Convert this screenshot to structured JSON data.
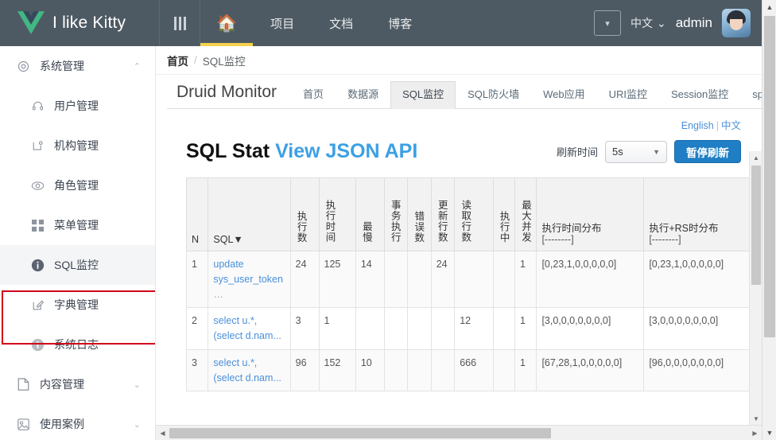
{
  "header": {
    "brand_title": "I like Kitty",
    "logo_icon": "vue-logo-icon",
    "menu_icon": "hamburger-icon",
    "home_icon": "home-icon",
    "nav": [
      {
        "label": "项目"
      },
      {
        "label": "文档"
      },
      {
        "label": "博客"
      }
    ],
    "collapse_icon": "chevron-down-icon",
    "lang_label": "中文",
    "lang_caret": "⌄",
    "username": "admin",
    "avatar": "user-avatar"
  },
  "sidebar": {
    "items": [
      {
        "label": "系统管理",
        "icon": "gear-icon",
        "level": "group",
        "arrow": "⌃",
        "selected": false
      },
      {
        "label": "用户管理",
        "icon": "headset-icon",
        "level": "sub",
        "arrow": "",
        "selected": false
      },
      {
        "label": "机构管理",
        "icon": "org-icon",
        "level": "sub",
        "arrow": "",
        "selected": false
      },
      {
        "label": "角色管理",
        "icon": "eye-icon",
        "level": "sub",
        "arrow": "",
        "selected": false
      },
      {
        "label": "菜单管理",
        "icon": "grid-icon",
        "level": "sub",
        "arrow": "",
        "selected": false
      },
      {
        "label": "SQL监控",
        "icon": "info-icon",
        "level": "sub",
        "arrow": "",
        "selected": true
      },
      {
        "label": "字典管理",
        "icon": "edit-icon",
        "level": "sub",
        "arrow": "",
        "selected": false
      },
      {
        "label": "系统日志",
        "icon": "info-icon",
        "level": "sub",
        "arrow": "",
        "selected": false
      },
      {
        "label": "内容管理",
        "icon": "doc-icon",
        "level": "group",
        "arrow": "⌄",
        "selected": false
      },
      {
        "label": "使用案例",
        "icon": "case-icon",
        "level": "group",
        "arrow": "⌄",
        "selected": false
      }
    ],
    "highlight_color": "#d0021b"
  },
  "breadcrumb": {
    "home": "首页",
    "separator": "/",
    "current": "SQL监控"
  },
  "druid": {
    "brand": "Druid Monitor",
    "tabs": [
      {
        "label": "首页",
        "active": false
      },
      {
        "label": "数据源",
        "active": false
      },
      {
        "label": "SQL监控",
        "active": true
      },
      {
        "label": "SQL防火墙",
        "active": false
      },
      {
        "label": "Web应用",
        "active": false
      },
      {
        "label": "URI监控",
        "active": false
      },
      {
        "label": "Session监控",
        "active": false
      },
      {
        "label": "spring监控",
        "active": false
      }
    ],
    "lang_english": "English",
    "lang_separator": "|",
    "lang_chinese": "中文",
    "stat_title": "SQL Stat ",
    "stat_api_link": "View JSON API",
    "refresh_label": "刷新时间",
    "refresh_value": "5s",
    "refresh_caret": "▼",
    "pause_button": "暂停刷新",
    "accent_blue": "#1f7ec4"
  },
  "table": {
    "columns": [
      {
        "key": "n",
        "label": "N",
        "vertical": false
      },
      {
        "key": "sql",
        "label": "SQL▼",
        "vertical": false
      },
      {
        "key": "exec_count",
        "label": "执行数",
        "vertical": true
      },
      {
        "key": "exec_time",
        "label": "执行时间",
        "vertical": true
      },
      {
        "key": "slowest",
        "label": "最慢",
        "vertical": true
      },
      {
        "key": "tx_exec",
        "label": "事务执行",
        "vertical": true
      },
      {
        "key": "err_count",
        "label": "错误数",
        "vertical": true
      },
      {
        "key": "update_rows",
        "label": "更新行数",
        "vertical": true
      },
      {
        "key": "read_rows",
        "label": "读取行数",
        "vertical": true
      },
      {
        "key": "running",
        "label": "执行中",
        "vertical": true
      },
      {
        "key": "max_conc",
        "label": "最大并发",
        "vertical": true
      },
      {
        "key": "exec_dist",
        "label": "执行时间分布",
        "label2": "[--------]",
        "vertical": false
      },
      {
        "key": "rs_dist",
        "label": "执行+RS时分布",
        "label2": "[--------]",
        "vertical": false
      }
    ],
    "rows": [
      {
        "n": "1",
        "sql_line1": "update",
        "sql_line2": "sys_user_token",
        "sql_ellipsis": "…",
        "exec_count": "24",
        "exec_time": "125",
        "slowest": "14",
        "tx_exec": "",
        "err_count": "",
        "update_rows": "24",
        "read_rows": "",
        "running": "",
        "max_conc": "1",
        "exec_dist": "[0,23,1,0,0,0,0,0]",
        "rs_dist": "[0,23,1,0,0,0,0,0]"
      },
      {
        "n": "2",
        "sql_line1": "select u.*,",
        "sql_line2": "(select d.nam...",
        "sql_ellipsis": "",
        "exec_count": "3",
        "exec_time": "1",
        "slowest": "",
        "tx_exec": "",
        "err_count": "",
        "update_rows": "",
        "read_rows": "12",
        "running": "",
        "max_conc": "1",
        "exec_dist": "[3,0,0,0,0,0,0,0]",
        "rs_dist": "[3,0,0,0,0,0,0,0]"
      },
      {
        "n": "3",
        "sql_line1": "select u.*,",
        "sql_line2": "(select d.nam...",
        "sql_ellipsis": "",
        "exec_count": "96",
        "exec_time": "152",
        "slowest": "10",
        "tx_exec": "",
        "err_count": "",
        "update_rows": "",
        "read_rows": "666",
        "running": "",
        "max_conc": "1",
        "exec_dist": "[67,28,1,0,0,0,0,0]",
        "rs_dist": "[96,0,0,0,0,0,0,0]"
      }
    ]
  },
  "scrollbars": {
    "left_arrow": "◀",
    "right_arrow": "▶",
    "up_arrow": "▲",
    "down_arrow": "▼"
  }
}
